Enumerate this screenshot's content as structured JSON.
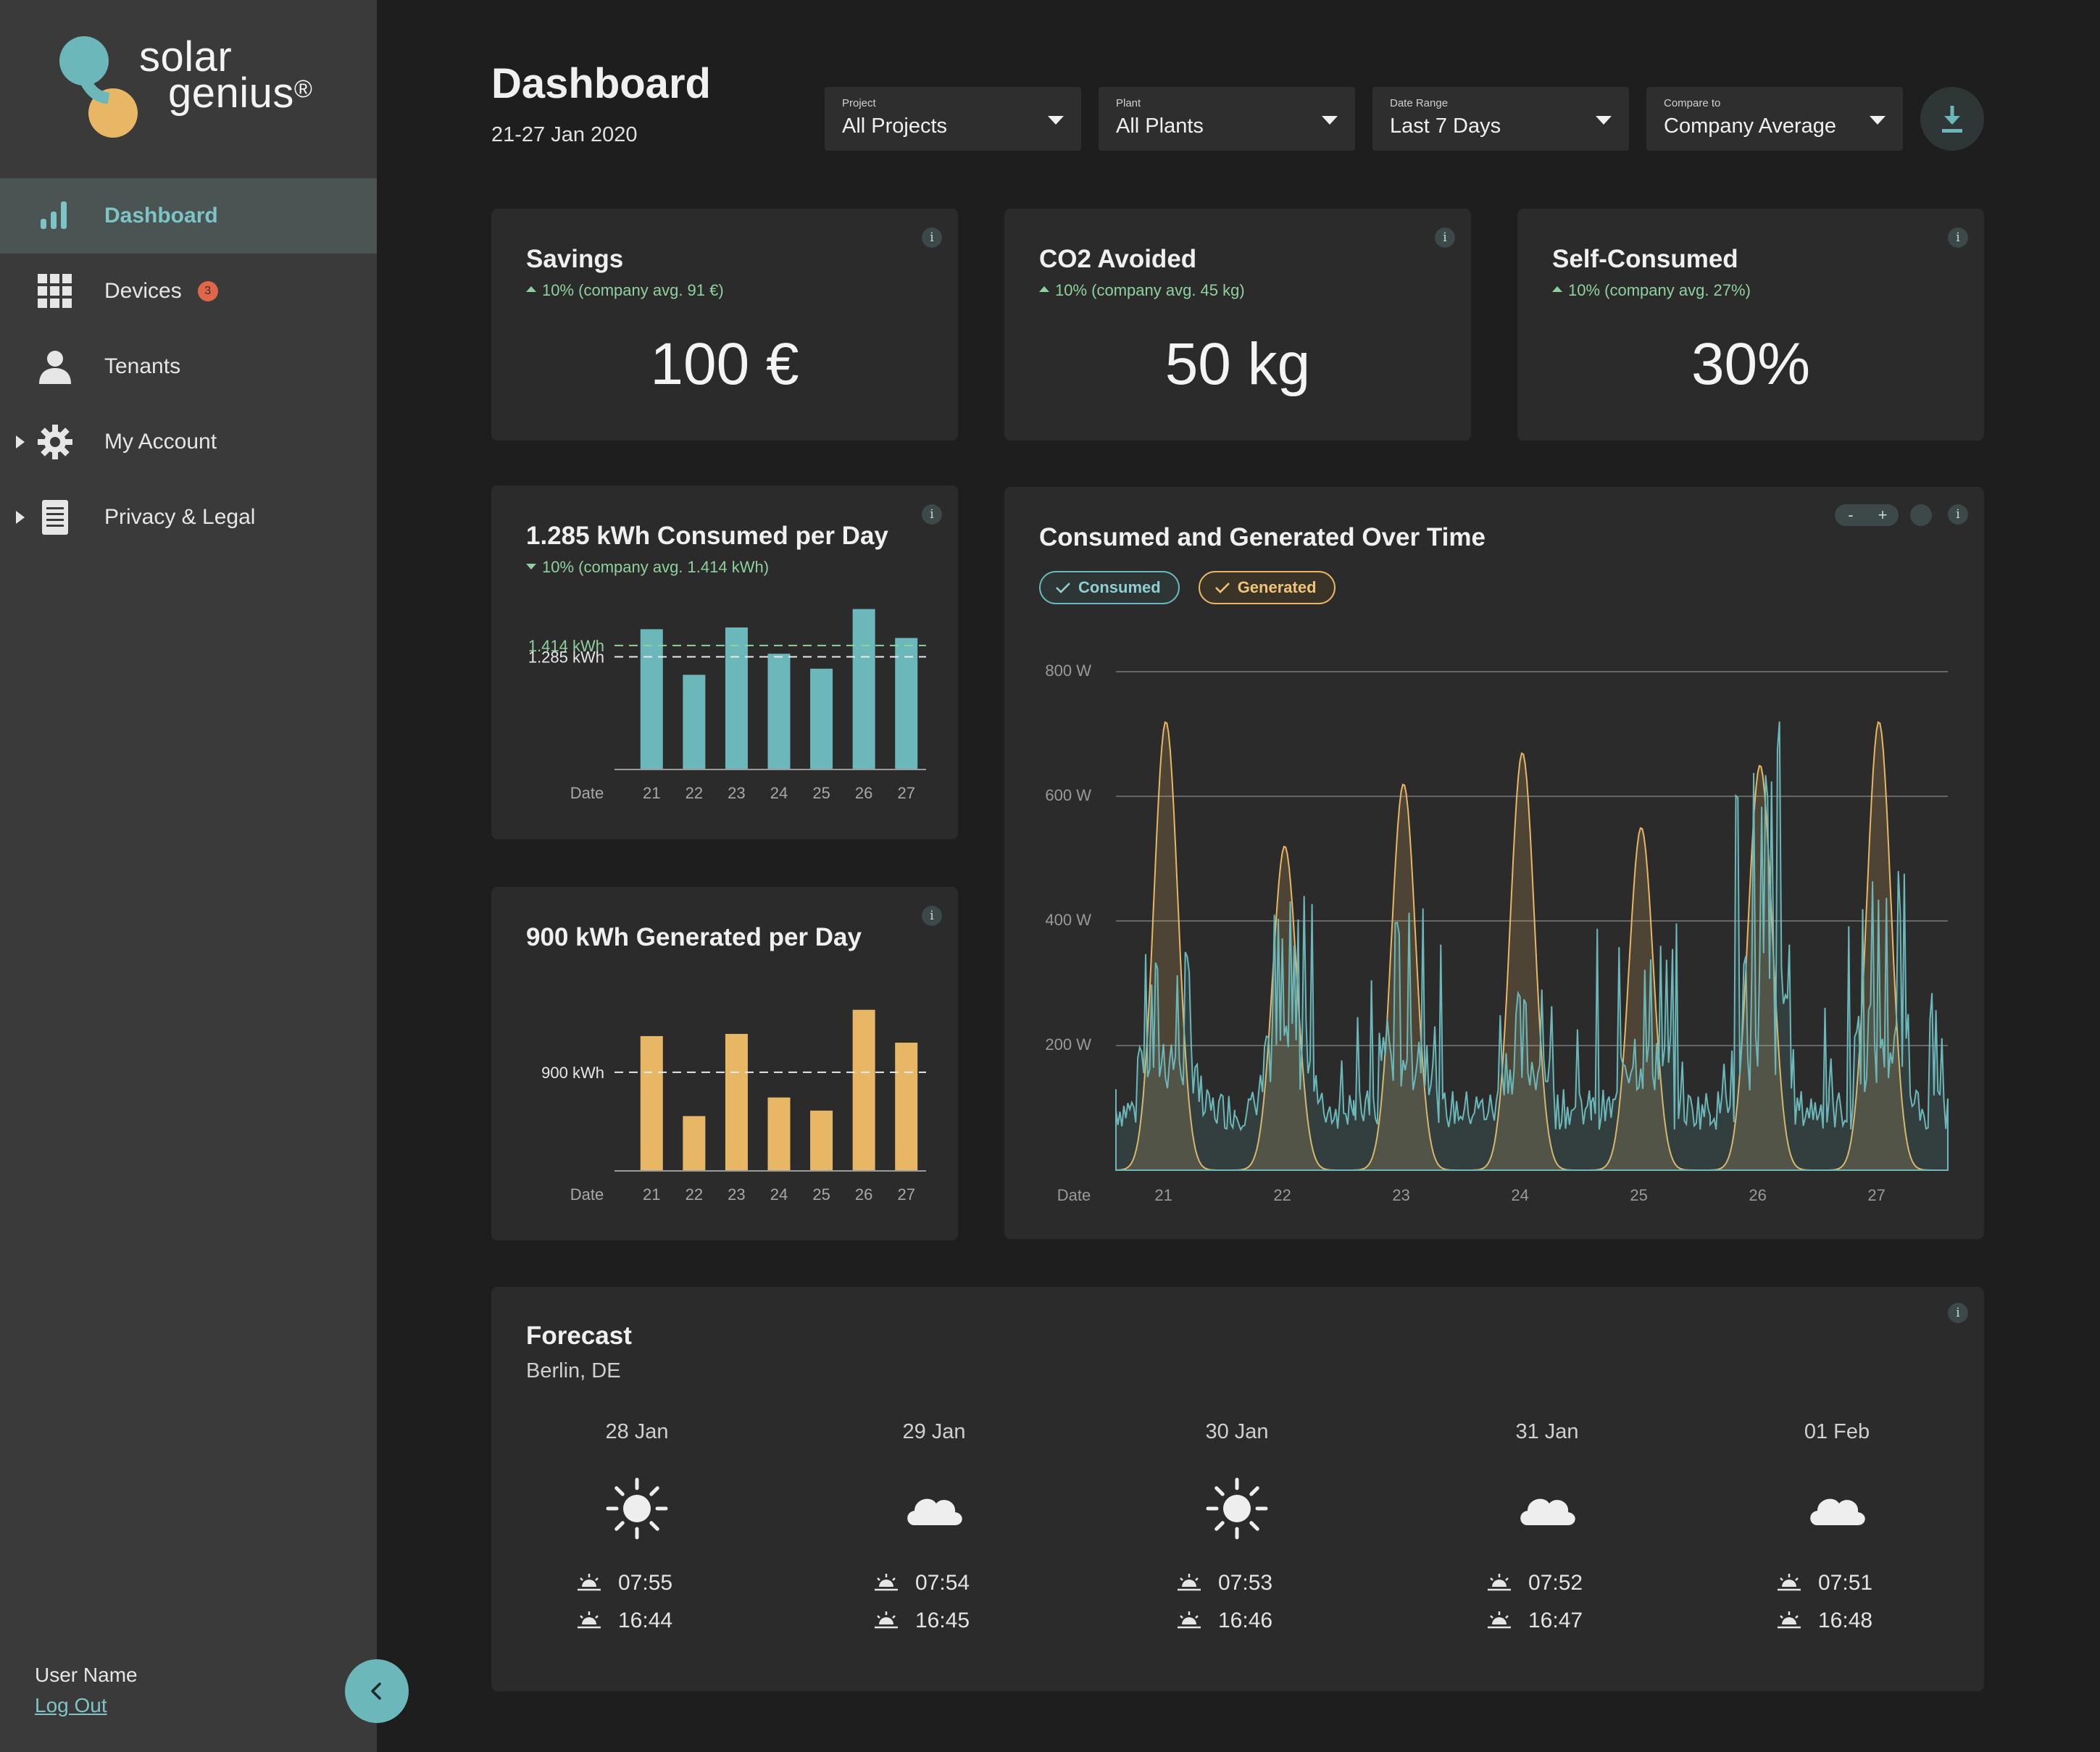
{
  "brand": {
    "line1": "solar",
    "line2": "genius",
    "mark": "®"
  },
  "sidebar": {
    "items": [
      {
        "label": "Dashboard",
        "icon": "bar-chart-icon",
        "active": true
      },
      {
        "label": "Devices",
        "icon": "grid-icon",
        "badge": "3"
      },
      {
        "label": "Tenants",
        "icon": "person-icon"
      },
      {
        "label": "My Account",
        "icon": "gear-icon",
        "expandable": true
      },
      {
        "label": "Privacy & Legal",
        "icon": "document-icon",
        "expandable": true
      }
    ],
    "user_name": "User Name",
    "logout": "Log Out"
  },
  "header": {
    "title": "Dashboard",
    "subtitle": "21-27 Jan 2020",
    "filters": [
      {
        "label": "Project",
        "value": "All Projects"
      },
      {
        "label": "Plant",
        "value": "All Plants"
      },
      {
        "label": "Date Range",
        "value": "Last 7 Days"
      },
      {
        "label": "Compare to",
        "value": "Company Average"
      }
    ]
  },
  "kpis": [
    {
      "title": "Savings",
      "delta": "10% (company avg.  91 €)",
      "value": "100 €"
    },
    {
      "title": "CO2 Avoided",
      "delta": "10% (company avg. 45 kg)",
      "value": "50 kg"
    },
    {
      "title": "Self-Consumed",
      "delta": "10% (company avg. 27%)",
      "value": "30%"
    }
  ],
  "consumed_card": {
    "title": "1.285 kWh Consumed per Day",
    "delta": "10% (company avg. 1.414 kWh)"
  },
  "generated_card": {
    "title": "900 kWh Generated per Day"
  },
  "timeseries_card": {
    "title": "Consumed and Generated Over Time",
    "chips": [
      "Consumed",
      "Generated"
    ],
    "zoom_minus": "-",
    "zoom_plus": "+"
  },
  "forecast": {
    "title": "Forecast",
    "location": "Berlin, DE",
    "days": [
      {
        "date": "28 Jan",
        "weather": "sun-icon",
        "sunrise": "07:55",
        "sunset": "16:44"
      },
      {
        "date": "29 Jan",
        "weather": "cloud-icon",
        "sunrise": "07:54",
        "sunset": "16:45"
      },
      {
        "date": "30 Jan",
        "weather": "sun-icon",
        "sunrise": "07:53",
        "sunset": "16:46"
      },
      {
        "date": "31 Jan",
        "weather": "cloud-icon",
        "sunrise": "07:52",
        "sunset": "16:47"
      },
      {
        "date": "01 Feb",
        "weather": "cloud-icon",
        "sunrise": "07:51",
        "sunset": "16:48"
      }
    ]
  },
  "colors": {
    "accent_teal": "#6bb7b9",
    "accent_amber": "#e8b765",
    "positive_green": "#8fd19e",
    "badge_red": "#e0664a"
  },
  "chart_data": [
    {
      "type": "bar",
      "xlabel": "Date",
      "categories": [
        "21",
        "22",
        "23",
        "24",
        "25",
        "26",
        "27"
      ],
      "values": [
        1.6,
        1.08,
        1.62,
        1.32,
        1.15,
        1.83,
        1.5
      ],
      "reference_lines": [
        {
          "label": "1.414 kWh",
          "value": 1.414,
          "color": "#8fd19e"
        },
        {
          "label": "1.285 kWh",
          "value": 1.285,
          "color": "#e8e8e8"
        }
      ],
      "ylim": [
        0,
        2
      ],
      "color": "#6bb7b9"
    },
    {
      "type": "bar",
      "xlabel": "Date",
      "categories": [
        "21",
        "22",
        "23",
        "24",
        "25",
        "26",
        "27"
      ],
      "values": [
        1230,
        500,
        1250,
        670,
        550,
        1470,
        1170
      ],
      "reference_lines": [
        {
          "label": "900 kWh",
          "value": 900,
          "color": "#e8e8e8"
        }
      ],
      "ylim": [
        0,
        1600
      ],
      "color": "#e8b765"
    },
    {
      "type": "area",
      "xlabel": "Date",
      "x_ticks": [
        "21",
        "22",
        "23",
        "24",
        "25",
        "26",
        "27"
      ],
      "y_ticks": [
        "800 W",
        "600 W",
        "400 W",
        "200 W"
      ],
      "ylim": [
        0,
        800
      ],
      "grid": true,
      "series": [
        {
          "name": "Generated",
          "color": "#e8b765",
          "daily_peaks_w": [
            720,
            520,
            620,
            670,
            550,
            650,
            720
          ]
        },
        {
          "name": "Consumed",
          "color": "#6bb7b9",
          "baseline_w": 130,
          "daily_spike_max_w": [
            350,
            440,
            420,
            290,
            360,
            720,
            480
          ]
        }
      ]
    }
  ]
}
